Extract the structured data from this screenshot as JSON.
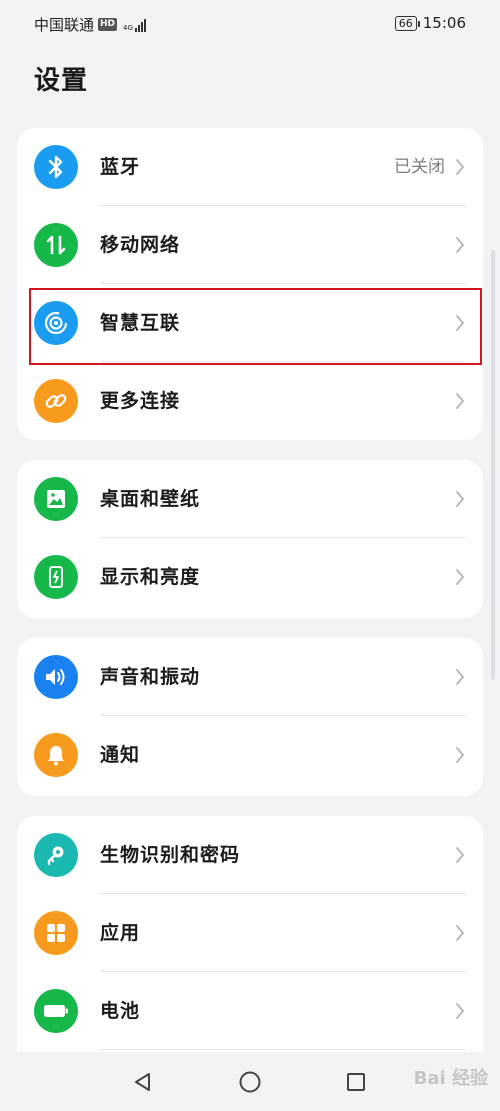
{
  "status_bar": {
    "carrier": "中国联通",
    "hd_badge": "HD",
    "network_type": "4G",
    "battery_level": "66",
    "time": "15:06"
  },
  "header": {
    "title": "设置"
  },
  "groups": [
    {
      "items": [
        {
          "label": "蓝牙",
          "value": "已关闭",
          "icon": "bluetooth-icon",
          "icon_color": "#1a9cf0"
        },
        {
          "label": "移动网络",
          "value": "",
          "icon": "mobile-network-icon",
          "icon_color": "#16b84a"
        },
        {
          "label": "智慧互联",
          "value": "",
          "icon": "smart-connect-icon",
          "icon_color": "#1a9cf0"
        },
        {
          "label": "更多连接",
          "value": "",
          "icon": "link-icon",
          "icon_color": "#f79a1e"
        }
      ]
    },
    {
      "items": [
        {
          "label": "桌面和壁纸",
          "value": "",
          "icon": "wallpaper-icon",
          "icon_color": "#16b84a"
        },
        {
          "label": "显示和亮度",
          "value": "",
          "icon": "display-icon",
          "icon_color": "#16b84a"
        }
      ]
    },
    {
      "items": [
        {
          "label": "声音和振动",
          "value": "",
          "icon": "sound-icon",
          "icon_color": "#1a82f0"
        },
        {
          "label": "通知",
          "value": "",
          "icon": "bell-icon",
          "icon_color": "#f79a1e"
        }
      ]
    },
    {
      "items": [
        {
          "label": "生物识别和密码",
          "value": "",
          "icon": "key-icon",
          "icon_color": "#19b8b0"
        },
        {
          "label": "应用",
          "value": "",
          "icon": "apps-icon",
          "icon_color": "#f79a1e"
        },
        {
          "label": "电池",
          "value": "",
          "icon": "battery-icon",
          "icon_color": "#16b84a"
        }
      ]
    }
  ],
  "nav_bar": {
    "back": "back-icon",
    "home": "home-icon",
    "recents": "recents-icon"
  },
  "watermark": "Bai 经验"
}
